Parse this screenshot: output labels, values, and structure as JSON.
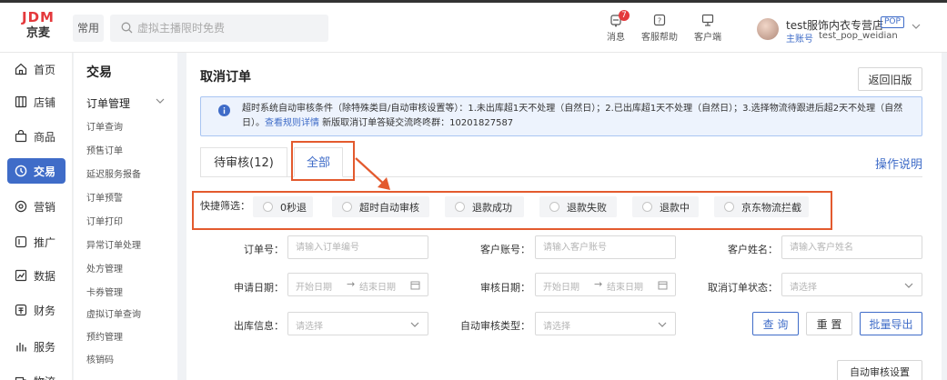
{
  "header": {
    "logo_top": "JDM",
    "logo_bottom": "京麦",
    "common_label": "常用",
    "search_placeholder": "虚拟主播限时免费",
    "icons": [
      {
        "label": "消息",
        "badge": "7",
        "icon": "bell-icon"
      },
      {
        "label": "客服帮助",
        "icon": "help-icon"
      },
      {
        "label": "客户端",
        "icon": "monitor-icon"
      }
    ],
    "shop_name": "test服饰内衣专营店",
    "shop_tag": "POP",
    "account_type": "主账号",
    "account_name": "test_pop_weidian"
  },
  "sidebar": {
    "items": [
      {
        "label": "首页",
        "icon": "home-icon"
      },
      {
        "label": "店铺",
        "icon": "store-icon"
      },
      {
        "label": "商品",
        "icon": "bag-icon"
      },
      {
        "label": "交易",
        "icon": "trade-icon",
        "active": true
      },
      {
        "label": "营销",
        "icon": "marketing-icon"
      },
      {
        "label": "推广",
        "icon": "promotion-icon"
      },
      {
        "label": "数据",
        "icon": "data-icon"
      },
      {
        "label": "财务",
        "icon": "finance-icon"
      },
      {
        "label": "服务",
        "icon": "service-icon"
      },
      {
        "label": "物流",
        "icon": "logistics-icon"
      }
    ]
  },
  "subnav": {
    "title": "交易",
    "group": "订单管理",
    "items": [
      "订单查询",
      "预售订单",
      "延迟服务报备",
      "订单预警",
      "订单打印",
      "异常订单处理",
      "处方管理",
      "卡券管理",
      "虚拟订单查询",
      "预约管理",
      "核销码"
    ]
  },
  "main": {
    "title": "取消订单",
    "back_button": "返回旧版",
    "info_text": "超时系统自动审核条件（除特殊类目/自动审核设置等）：1.未出库超1天不处理（自然日）；2.已出库超1天不处理（自然日）；3.选择物流待跟进后超2天不处理（自然日）。",
    "info_link": "查看规则详情",
    "info_suffix": " 新版取消订单答疑交流咚咚群：10201827587",
    "tabs": [
      {
        "label": "待审核(12)"
      },
      {
        "label": "全部",
        "active": true
      }
    ],
    "help_link": "操作说明",
    "quick_filter_label": "快捷筛选：",
    "quick_filters": [
      "0秒退",
      "超时自动审核",
      "退款成功",
      "退款失败",
      "退款中",
      "京东物流拦截"
    ],
    "form": {
      "order_no_label": "订单号：",
      "order_no_placeholder": "请输入订单编号",
      "customer_account_label": "客户账号：",
      "customer_account_placeholder": "请输入客户账号",
      "customer_name_label": "客户姓名：",
      "customer_name_placeholder": "请输入客户姓名",
      "apply_date_label": "申请日期：",
      "review_date_label": "审核日期：",
      "date_start": "开始日期",
      "date_arrow": "→",
      "date_end": "结束日期",
      "cancel_status_label": "取消订单状态：",
      "select_placeholder": "请选择",
      "outbound_label": "出库信息：",
      "auto_review_type_label": "自动审核类型："
    },
    "buttons": {
      "query": "查 询",
      "reset": "重 置",
      "export": "批量导出",
      "auto_review": "自动审核设置"
    }
  },
  "colors": {
    "brand_red": "#e4393c",
    "accent_blue": "#3f6cc8",
    "highlight_orange": "#e35a2e"
  }
}
